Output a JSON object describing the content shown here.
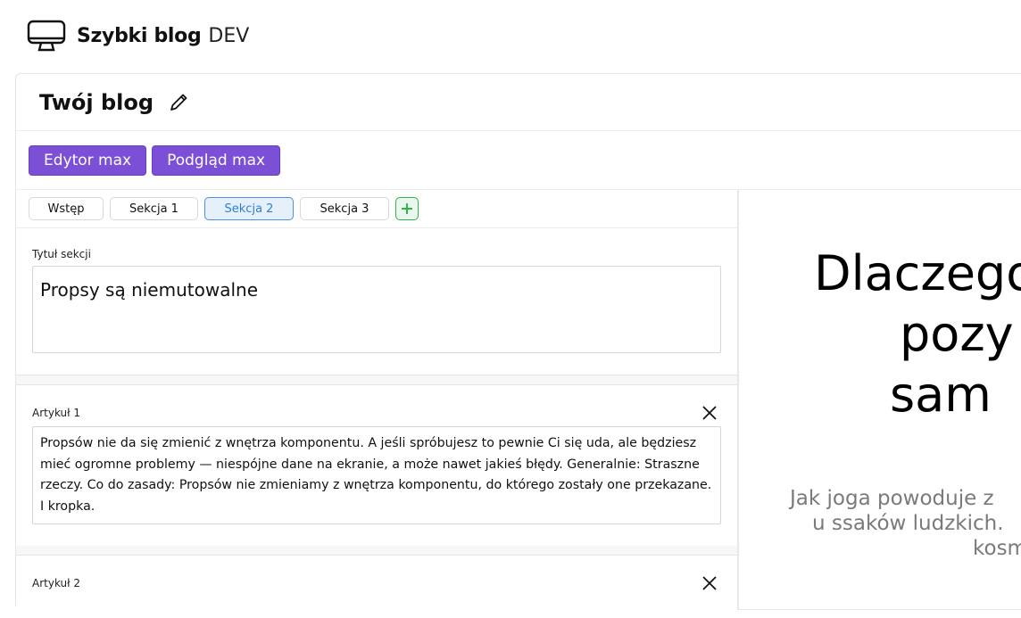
{
  "app": {
    "brand": "Szybki blog",
    "env": "DEV"
  },
  "blog": {
    "title": "Twój blog"
  },
  "toolbar": {
    "editor_max": "Edytor max",
    "preview_max": "Podgląd max"
  },
  "tabs": [
    {
      "label": "Wstęp",
      "active": false
    },
    {
      "label": "Sekcja 1",
      "active": false
    },
    {
      "label": "Sekcja 2",
      "active": true
    },
    {
      "label": "Sekcja 3",
      "active": false
    }
  ],
  "section": {
    "title_label": "Tytuł sekcji",
    "title_value": "Propsy są niemutowalne"
  },
  "articles": [
    {
      "label": "Artykuł 1",
      "text": "Propsów nie da się zmienić z wnętrza komponentu. A jeśli spróbujesz to pewnie Ci się uda, ale będziesz mieć ogromne problemy — niespójne dane na ekranie, a może nawet jakieś błędy. Generalnie: Straszne rzeczy. Co do zasady: Propsów nie zmieniamy z wnętrza komponentu, do którego zostały one przekazane. I kropka."
    },
    {
      "label": "Artykuł 2",
      "text": ""
    }
  ],
  "preview": {
    "title_lines": [
      "Dlaczego",
      "pozy",
      "sam"
    ],
    "lead_lines": [
      "Jak joga powoduje z",
      "u ssaków ludzkich.",
      "kosm"
    ]
  },
  "colors": {
    "accent": "#7b4fd6",
    "active_tab": "#4a8fe0",
    "add": "#31b44a"
  },
  "icons": {
    "logo": "monitor-icon",
    "edit": "pencil-icon",
    "add": "plus-icon",
    "close": "close-icon"
  }
}
